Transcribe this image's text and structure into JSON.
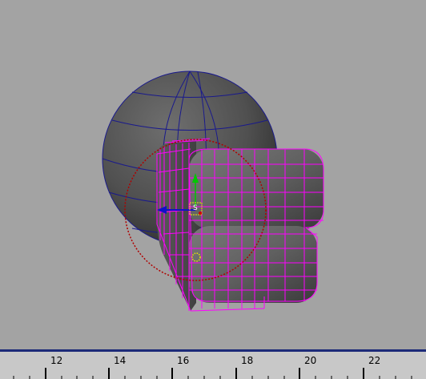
{
  "viewport": {
    "background_color": "#a3a3a3",
    "wireframe_color": "#ff00ff",
    "sphere_wire_color": "#1a1a8c",
    "manipulator_circle_color": "#b00000",
    "pivot_label": "S"
  },
  "timeline": {
    "accent_color": "#1c2a78",
    "ticks": [
      {
        "label": "12"
      },
      {
        "label": "14"
      },
      {
        "label": "16"
      },
      {
        "label": "18"
      },
      {
        "label": "20"
      },
      {
        "label": "22"
      }
    ]
  }
}
